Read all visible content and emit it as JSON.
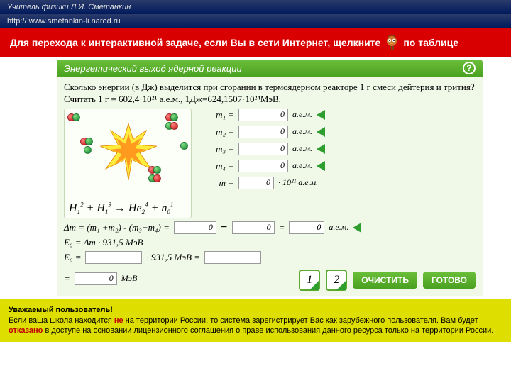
{
  "header": {
    "author": "Учитель физики Л.И. Сметанкин",
    "url": "http:// www.smetankin-li.narod.ru"
  },
  "redbar": {
    "t1": "Для перехода к интерактивной задаче, если Вы в сети Интернет, щелкните",
    "t2": "по таблице"
  },
  "app": {
    "title": "Энергетический выход ядерной реакции",
    "help": "?",
    "question": "Сколько энергии (в Дж) выделится при сгорании в термоядерном реакторе 1 г смеси дейтерия и трития? Считать 1 г = 602,4·10²¹ а.е.м., 1Дж=624,1507·10²⁴МэВ.",
    "equation": "H₁² + H₁³  →  He₂⁴ + n₀¹",
    "rows": [
      {
        "label": "m₁ =",
        "value": "0",
        "unit": "а.е.м."
      },
      {
        "label": "m₂ =",
        "value": "0",
        "unit": "а.е.м."
      },
      {
        "label": "m₃ =",
        "value": "0",
        "unit": "а.е.м."
      },
      {
        "label": "m₄ =",
        "value": "0",
        "unit": "а.е.м."
      },
      {
        "label": "m =",
        "value": "0",
        "unit": "· 10²¹ а.е.м."
      }
    ],
    "dm_label": "Δm = (m₁ +m₂)  -  (m₃+m₄) =",
    "dm_v1": "0",
    "dm_op": "−",
    "dm_v2": "0",
    "dm_eq": "=",
    "dm_v3": "0",
    "dm_unit": "а.е.м.",
    "e0_label": "E₀ = Δm · 931,5  МэВ",
    "e0_row": {
      "lbl": "E₀  =",
      "v": "",
      "mid": "·  931,5  МэВ   =",
      "v2": ""
    },
    "final": {
      "lbl": "=",
      "v": "0",
      "unit": "МэВ"
    },
    "steps": [
      "1",
      "2"
    ],
    "clear": "ОЧИСТИТЬ",
    "done": "ГОТОВО"
  },
  "notice": {
    "h": "Уважаемый пользователь!",
    "l1a": "Если ваша школа находится ",
    "l1b": "не",
    "l1c": " на территории России, то система зарегистрирует Вас как зарубежного пользователя. Вам будет ",
    "l1d": "отказано",
    "l1e": " в доступе на основании лицензионного соглашения о праве использования данного ресурса только на территории России."
  }
}
